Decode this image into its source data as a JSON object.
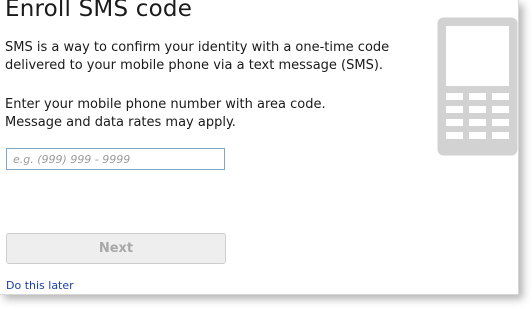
{
  "title": "Enroll SMS code",
  "description_lines": [
    "SMS is a way to confirm your identity with a one-time code",
    "delivered to your mobile phone via a text message (SMS)."
  ],
  "instruction_lines": [
    "Enter your mobile phone number with area code.",
    "Message and data rates may apply."
  ],
  "phone_input": {
    "value": "",
    "placeholder": "e.g. (999) 999 - 9999"
  },
  "next_button": {
    "label": "Next",
    "enabled": false
  },
  "later_link": "Do this later",
  "colors": {
    "link": "#1a3fae",
    "input_border": "#7fa9c6",
    "button_disabled_text": "#a8a8a8",
    "phone_graphic": "#d2d2d2"
  },
  "icons": {
    "phone": "mobile-phone-icon"
  }
}
